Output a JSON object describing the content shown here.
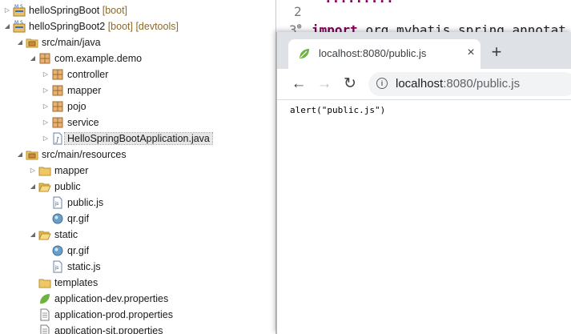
{
  "explorer": {
    "items": [
      {
        "label": "helloSpringBoot",
        "decoration": "[boot]",
        "icon": "boot-project-icon",
        "arrow": "collapsed"
      },
      {
        "label": "helloSpringBoot2",
        "decoration": "[boot] [devtools]",
        "icon": "boot-project-icon",
        "arrow": "expanded"
      },
      {
        "label": "src/main/java",
        "decoration": "",
        "icon": "source-folder-icon",
        "arrow": "expanded"
      },
      {
        "label": "com.example.demo",
        "decoration": "",
        "icon": "package-icon",
        "arrow": "expanded"
      },
      {
        "label": "controller",
        "decoration": "",
        "icon": "package-icon",
        "arrow": "collapsed"
      },
      {
        "label": "mapper",
        "decoration": "",
        "icon": "package-icon",
        "arrow": "collapsed"
      },
      {
        "label": "pojo",
        "decoration": "",
        "icon": "package-icon",
        "arrow": "collapsed"
      },
      {
        "label": "service",
        "decoration": "",
        "icon": "package-icon",
        "arrow": "collapsed"
      },
      {
        "label": "HelloSpringBootApplication.java",
        "decoration": "",
        "icon": "java-file-icon",
        "arrow": "collapsed",
        "selected": true
      },
      {
        "label": "src/main/resources",
        "decoration": "",
        "icon": "source-folder-icon",
        "arrow": "expanded"
      },
      {
        "label": "mapper",
        "decoration": "",
        "icon": "folder-icon",
        "arrow": "collapsed"
      },
      {
        "label": "public",
        "decoration": "",
        "icon": "folder-open-icon",
        "arrow": "expanded"
      },
      {
        "label": "public.js",
        "decoration": "",
        "icon": "js-file-icon",
        "arrow": "none"
      },
      {
        "label": "qr.gif",
        "decoration": "",
        "icon": "image-file-icon",
        "arrow": "none"
      },
      {
        "label": "static",
        "decoration": "",
        "icon": "folder-open-icon",
        "arrow": "expanded"
      },
      {
        "label": "qr.gif",
        "decoration": "",
        "icon": "image-file-icon",
        "arrow": "none"
      },
      {
        "label": "static.js",
        "decoration": "",
        "icon": "js-file-icon",
        "arrow": "none"
      },
      {
        "label": "templates",
        "decoration": "",
        "icon": "folder-icon",
        "arrow": "none"
      },
      {
        "label": "application-dev.properties",
        "decoration": "",
        "icon": "spring-properties-icon",
        "arrow": "none"
      },
      {
        "label": "application-prod.properties",
        "decoration": "",
        "icon": "properties-file-icon",
        "arrow": "none"
      },
      {
        "label": "application-sit.properties",
        "decoration": "",
        "icon": "properties-file-icon",
        "arrow": "none"
      }
    ]
  },
  "editor": {
    "line2_number": "2",
    "line3_number": "3",
    "line3_keyword": "import",
    "line3_code": "org.mybatis.spring.annotat"
  },
  "browser": {
    "tab_title": "localhost:8080/public.js",
    "close_glyph": "×",
    "newtab_glyph": "+",
    "back_glyph": "←",
    "forward_glyph": "→",
    "reload_glyph": "↻",
    "url_host": "localhost",
    "url_rest": ":8080/public.js",
    "page_text": "alert(\"public.js\")"
  },
  "colors": {
    "keyword": "#7f0055",
    "decoration": "#8a6a2e",
    "tab_strip": "#dee1e6",
    "spring_green": "#6db33f"
  }
}
